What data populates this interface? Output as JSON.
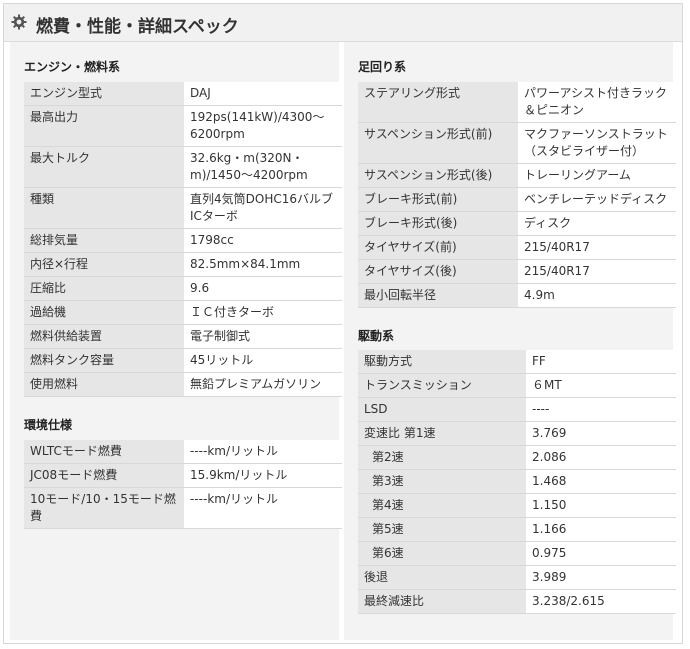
{
  "header": {
    "title": "燃費・性能・詳細スペック",
    "icon": "gear-icon"
  },
  "engine": {
    "title": "エンジン・燃料系",
    "rows": [
      {
        "k": "エンジン型式",
        "v": "DAJ"
      },
      {
        "k": "最高出力",
        "v": "192ps(141kW)/4300～6200rpm"
      },
      {
        "k": "最大トルク",
        "v": "32.6kg・m(320N・m)/1450～4200rpm"
      },
      {
        "k": "種類",
        "v": "直列4気筒DOHC16バルブICターボ"
      },
      {
        "k": "総排気量",
        "v": "1798cc"
      },
      {
        "k": "内径×行程",
        "v": "82.5mm×84.1mm"
      },
      {
        "k": "圧縮比",
        "v": "9.6"
      },
      {
        "k": "過給機",
        "v": "ＩＣ付きターボ"
      },
      {
        "k": "燃料供給装置",
        "v": "電子制御式"
      },
      {
        "k": "燃料タンク容量",
        "v": "45リットル"
      },
      {
        "k": "使用燃料",
        "v": "無鉛プレミアムガソリン"
      }
    ]
  },
  "environment": {
    "title": "環境仕様",
    "rows": [
      {
        "k": "WLTCモード燃費",
        "v": "----km/リットル"
      },
      {
        "k": "JC08モード燃費",
        "v": "15.9km/リットル"
      },
      {
        "k": "10モード/10・15モード燃費",
        "v": "----km/リットル"
      }
    ]
  },
  "suspension": {
    "title": "足回り系",
    "rows": [
      {
        "k": "ステアリング形式",
        "v": "パワーアシスト付きラック＆ピニオン"
      },
      {
        "k": "サスペンション形式(前)",
        "v": "マクファーソンストラット（スタビライザー付）"
      },
      {
        "k": "サスペンション形式(後)",
        "v": "トレーリングアーム"
      },
      {
        "k": "ブレーキ形式(前)",
        "v": "ベンチレーテッドディスク"
      },
      {
        "k": "ブレーキ形式(後)",
        "v": "ディスク"
      },
      {
        "k": "タイヤサイズ(前)",
        "v": "215/40R17"
      },
      {
        "k": "タイヤサイズ(後)",
        "v": "215/40R17"
      },
      {
        "k": "最小回転半径",
        "v": "4.9m"
      }
    ]
  },
  "drivetrain": {
    "title": "駆動系",
    "rows": [
      {
        "k": "駆動方式",
        "v": "FF"
      },
      {
        "k": "トランスミッション",
        "v": "６MT"
      },
      {
        "k": "LSD",
        "v": "----"
      },
      {
        "k": "変速比 第1速",
        "v": "3.769"
      },
      {
        "k": "第2速",
        "v": "2.086"
      },
      {
        "k": "第3速",
        "v": "1.468"
      },
      {
        "k": "第4速",
        "v": "1.150"
      },
      {
        "k": "第5速",
        "v": "1.166"
      },
      {
        "k": "第6速",
        "v": "0.975"
      },
      {
        "k": "後退",
        "v": "3.989"
      },
      {
        "k": "最終減速比",
        "v": "3.238/2.615"
      }
    ]
  }
}
